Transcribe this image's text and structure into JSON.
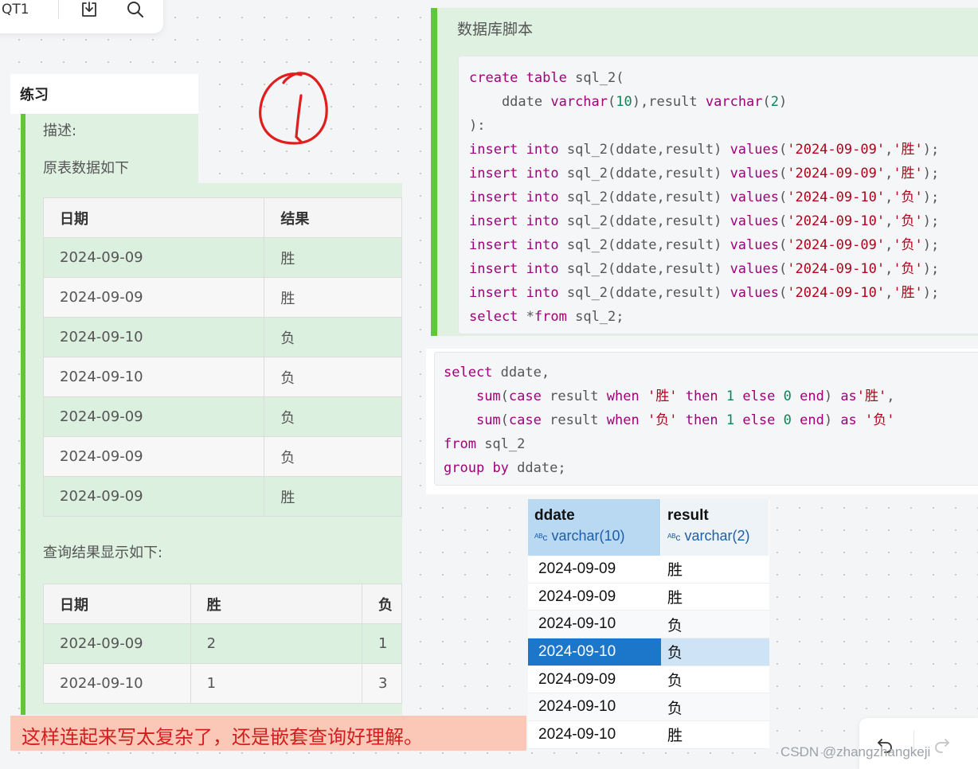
{
  "toolbar": {
    "doc_label": "QT1",
    "download_icon": "download-icon",
    "search_icon": "search-icon"
  },
  "practice": {
    "title": "练习",
    "description_label": "描述:",
    "source_label": "原表数据如下",
    "source_table": {
      "headers": [
        "日期",
        "结果"
      ],
      "rows": [
        [
          "2024-09-09",
          "胜"
        ],
        [
          "2024-09-09",
          "胜"
        ],
        [
          "2024-09-10",
          "负"
        ],
        [
          "2024-09-10",
          "负"
        ],
        [
          "2024-09-09",
          "负"
        ],
        [
          "2024-09-09",
          "负"
        ],
        [
          "2024-09-09",
          "胜"
        ]
      ]
    },
    "result_label": "查询结果显示如下:",
    "result_table": {
      "headers": [
        "日期",
        "胜",
        "负"
      ],
      "rows": [
        [
          "2024-09-09",
          "2",
          "1"
        ],
        [
          "2024-09-10",
          "1",
          "3"
        ]
      ]
    }
  },
  "annotation": {
    "handwritten_mark": "circled-number-one"
  },
  "script_block": {
    "title": "数据库脚本",
    "lines": [
      "create table sql_2(",
      "    ddate varchar(10),result varchar(2)",
      "):",
      "insert into sql_2(ddate,result) values('2024-09-09','胜');",
      "insert into sql_2(ddate,result) values('2024-09-09','胜');",
      "insert into sql_2(ddate,result) values('2024-09-10','负');",
      "insert into sql_2(ddate,result) values('2024-09-10','负');",
      "insert into sql_2(ddate,result) values('2024-09-09','负');",
      "insert into sql_2(ddate,result) values('2024-09-10','负');",
      "insert into sql_2(ddate,result) values('2024-09-10','胜');",
      "select *from sql_2;"
    ]
  },
  "query_block": {
    "lines": [
      "select ddate,",
      "    sum(case result when '胜' then 1 else 0 end) as'胜',",
      "    sum(case result when '负' then 1 else 0 end) as '负'",
      "from sql_2",
      "group by ddate;"
    ]
  },
  "result_grid": {
    "columns": [
      {
        "name": "ddate",
        "type": "varchar(10)",
        "type_icon": "abc-type-icon"
      },
      {
        "name": "result",
        "type": "varchar(2)",
        "type_icon": "abc-type-icon"
      }
    ],
    "rows": [
      [
        "2024-09-09",
        "胜"
      ],
      [
        "2024-09-09",
        "胜"
      ],
      [
        "2024-09-10",
        "负"
      ],
      [
        "2024-09-10",
        "负"
      ],
      [
        "2024-09-09",
        "负"
      ],
      [
        "2024-09-10",
        "负"
      ],
      [
        "2024-09-10",
        "胜"
      ]
    ],
    "selected_row": 3
  },
  "note": {
    "text": "这样连起来写太复杂了，还是嵌套查询好理解。"
  },
  "history": {
    "undo_icon": "undo-icon",
    "redo_icon": "redo-icon"
  },
  "watermark": "CSDN @zhangzhangkeji",
  "colors": {
    "accent_green": "#5fc739",
    "panel_green": "#dff2e2",
    "keyword": "#a0007a",
    "string": "#b3001b",
    "number": "#098658",
    "selection": "#1c76c9",
    "note_text": "#d41e1e"
  }
}
